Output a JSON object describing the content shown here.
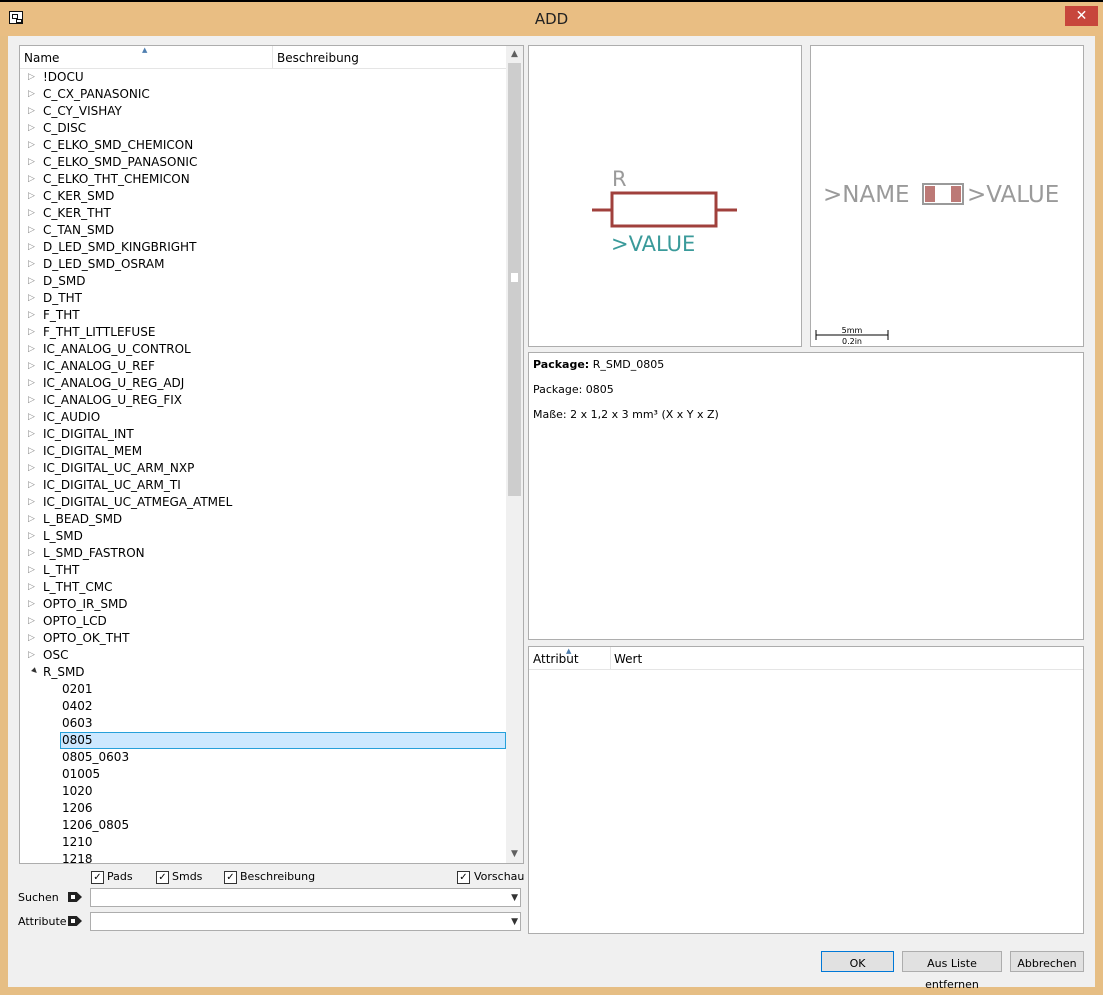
{
  "window": {
    "title": "ADD",
    "close_glyph": "✕"
  },
  "tree": {
    "columns": {
      "name": "Name",
      "description": "Beschreibung"
    },
    "libraries": [
      "!DOCU",
      "C_CX_PANASONIC",
      "C_CY_VISHAY",
      "C_DISC",
      "C_ELKO_SMD_CHEMICON",
      "C_ELKO_SMD_PANASONIC",
      "C_ELKO_THT_CHEMICON",
      "C_KER_SMD",
      "C_KER_THT",
      "C_TAN_SMD",
      "D_LED_SMD_KINGBRIGHT",
      "D_LED_SMD_OSRAM",
      "D_SMD",
      "D_THT",
      "F_THT",
      "F_THT_LITTLEFUSE",
      "IC_ANALOG_U_CONTROL",
      "IC_ANALOG_U_REF",
      "IC_ANALOG_U_REG_ADJ",
      "IC_ANALOG_U_REG_FIX",
      "IC_AUDIO",
      "IC_DIGITAL_INT",
      "IC_DIGITAL_MEM",
      "IC_DIGITAL_UC_ARM_NXP",
      "IC_DIGITAL_UC_ARM_TI",
      "IC_DIGITAL_UC_ATMEGA_ATMEL",
      "L_BEAD_SMD",
      "L_SMD",
      "L_SMD_FASTRON",
      "L_THT",
      "L_THT_CMC",
      "OPTO_IR_SMD",
      "OPTO_LCD",
      "OPTO_OK_THT",
      "OSC"
    ],
    "expanded_library": "R_SMD",
    "packages": [
      "0201",
      "0402",
      "0603",
      "0805",
      "0805_0603",
      "01005",
      "1020",
      "1206",
      "1206_0805",
      "1210",
      "1218"
    ],
    "selected_package": "0805"
  },
  "options": {
    "pads": {
      "label": "Pads",
      "checked": true
    },
    "smds": {
      "label": "Smds",
      "checked": true
    },
    "description": {
      "label": "Beschreibung",
      "checked": true
    },
    "preview": {
      "label": "Vorschau",
      "checked": true
    }
  },
  "filters": {
    "search_label": "Suchen",
    "search_value": "",
    "attribute_label": "Attribute",
    "attribute_value": ""
  },
  "schematic_preview": {
    "name_text": "R",
    "value_text": ">VALUE",
    "body_color": "#a0403c",
    "value_color": "#3a9a9a",
    "name_color": "#9a9a9a"
  },
  "package_preview": {
    "name_text": ">NAME",
    "value_text": ">VALUE",
    "scale_mm": "5mm",
    "scale_in": "0.2in"
  },
  "description": {
    "package_label": "Package:",
    "package_name": "R_SMD_0805",
    "line2": "Package: 0805",
    "line3": "Maße: 2 x 1,2 x 3 mm³ (X x Y x Z)"
  },
  "attributes": {
    "columns": {
      "attribute": "Attribut",
      "value": "Wert"
    }
  },
  "buttons": {
    "ok": "OK",
    "remove": "Aus Liste entfernen",
    "cancel": "Abbrechen"
  }
}
